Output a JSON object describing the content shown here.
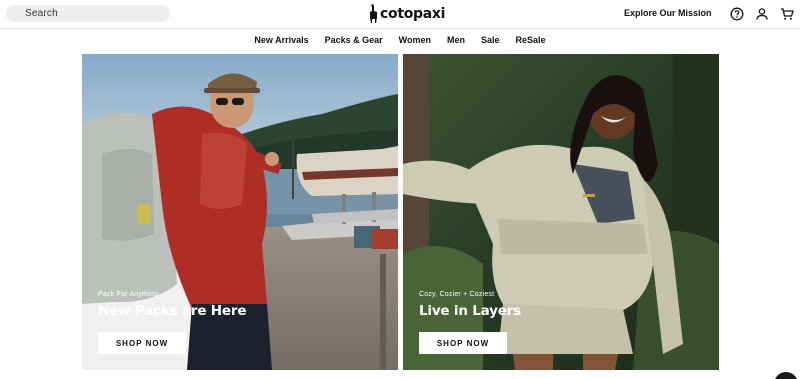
{
  "header": {
    "search_placeholder": "Search",
    "logo_text": "cotopaxi",
    "mission_link": "Explore Our Mission",
    "icons": [
      "help-icon",
      "account-icon",
      "cart-icon"
    ]
  },
  "nav": {
    "items": [
      {
        "label": "New Arrivals"
      },
      {
        "label": "Packs & Gear"
      },
      {
        "label": "Women"
      },
      {
        "label": "Men"
      },
      {
        "label": "Sale"
      },
      {
        "label": "ReSale"
      }
    ]
  },
  "hero": {
    "left": {
      "eyebrow": "Pack For Anything",
      "headline": "New Packs are Here",
      "cta": "SHOP NOW"
    },
    "right": {
      "eyebrow": "Cozy, Cozier + Coziest",
      "headline": "Live in Layers",
      "cta": "SHOP NOW"
    }
  },
  "colors": {
    "search_bg": "#efefef",
    "text": "#111111",
    "button_bg": "#ffffff"
  }
}
